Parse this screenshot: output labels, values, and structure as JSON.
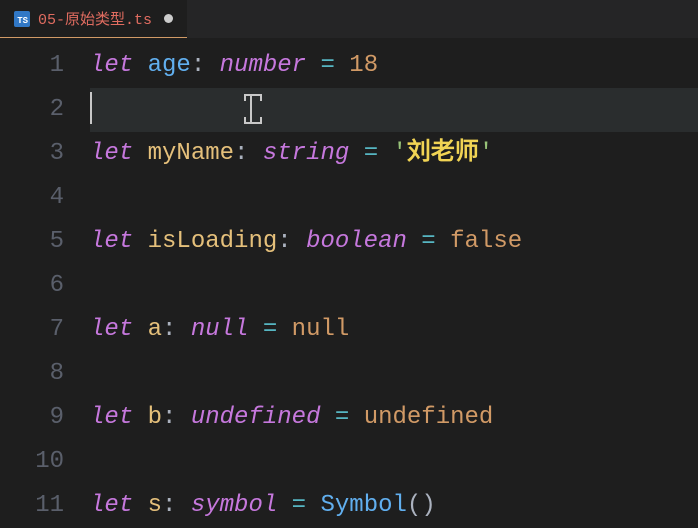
{
  "tab": {
    "icon_label": "TS",
    "filename": "05-原始类型.ts",
    "dirty": true
  },
  "editor": {
    "line_count": 11,
    "active_line": 2,
    "lines": {
      "1": {
        "kw": "let",
        "name": "age",
        "colon": ":",
        "type": "number",
        "eq": "=",
        "val": "18"
      },
      "3": {
        "kw": "let",
        "name": "myName",
        "colon": ":",
        "type": "string",
        "eq": "=",
        "q1": "'",
        "str": "刘老师",
        "q2": "'"
      },
      "5": {
        "kw": "let",
        "name": "isLoading",
        "colon": ":",
        "type": "boolean",
        "eq": "=",
        "val": "false"
      },
      "7": {
        "kw": "let",
        "name": "a",
        "colon": ":",
        "type": "null",
        "eq": "=",
        "val": "null"
      },
      "9": {
        "kw": "let",
        "name": "b",
        "colon": ":",
        "type": "undefined",
        "eq": "=",
        "val": "undefined"
      },
      "11": {
        "kw": "let",
        "name": "s",
        "colon": ":",
        "type": "symbol",
        "eq": "=",
        "func": "Symbol",
        "paren_open": "(",
        "paren_close": ")"
      }
    }
  }
}
